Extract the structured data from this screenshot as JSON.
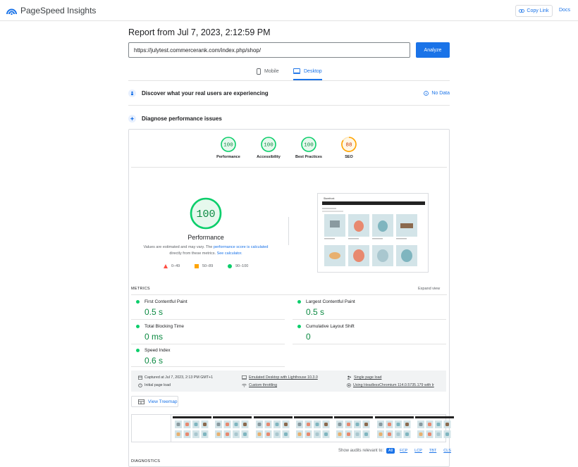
{
  "app": {
    "title": "PageSpeed Insights"
  },
  "header": {
    "copy_link": "Copy Link",
    "docs": "Docs"
  },
  "report": {
    "title": "Report from Jul 7, 2023, 2:12:59 PM",
    "url": "https://julytest.commercerank.com/index.php/shop/",
    "analyze_label": "Analyze"
  },
  "tabs": [
    {
      "label": "Mobile",
      "active": false
    },
    {
      "label": "Desktop",
      "active": true
    }
  ],
  "real_users": {
    "label": "Discover what your real users are experiencing",
    "status": "No Data"
  },
  "diagnose": {
    "label": "Diagnose performance issues"
  },
  "scores": [
    {
      "label": "Performance",
      "value": "100",
      "color": "#0cce6b"
    },
    {
      "label": "Accessibility",
      "value": "100",
      "color": "#0cce6b"
    },
    {
      "label": "Best Practices",
      "value": "100",
      "color": "#0cce6b"
    },
    {
      "label": "SEO",
      "value": "88",
      "color": "#ffa400"
    }
  ],
  "performance": {
    "score": "100",
    "title": "Performance",
    "note_1": "Values are estimated and may vary. The",
    "note_link_1": "performance score is calculated",
    "note_2": "directly from these metrics.",
    "note_link_2": "See calculator.",
    "legend": [
      "0–49",
      "50–89",
      "90–100"
    ]
  },
  "metrics": {
    "heading": "METRICS",
    "expand": "Expand view",
    "items": [
      {
        "name": "First Contentful Paint",
        "value": "0.5 s"
      },
      {
        "name": "Largest Contentful Paint",
        "value": "0.5 s"
      },
      {
        "name": "Total Blocking Time",
        "value": "0 ms"
      },
      {
        "name": "Cumulative Layout Shift",
        "value": "0"
      },
      {
        "name": "Speed Index",
        "value": "0.6 s"
      }
    ]
  },
  "run_info": {
    "captured": "Captured at Jul 7, 2023, 2:13 PM GMT+1",
    "initial": "Initial page load",
    "device": "Emulated Desktop with Lighthouse 10.3.0",
    "throttling": "Custom throttling",
    "session": "Single page load",
    "browser": "Using HeadlessChromium 114.0.5735.179 with lr"
  },
  "treemap_label": "View Treemap",
  "audits_filter": {
    "label": "Show audits relevant to:",
    "options": [
      "All",
      "FCP",
      "LCP",
      "TBT",
      "CLS"
    ]
  },
  "diagnostics_heading": "DIAGNOSTICS",
  "screenshot": {
    "site_name": "Storefront"
  }
}
